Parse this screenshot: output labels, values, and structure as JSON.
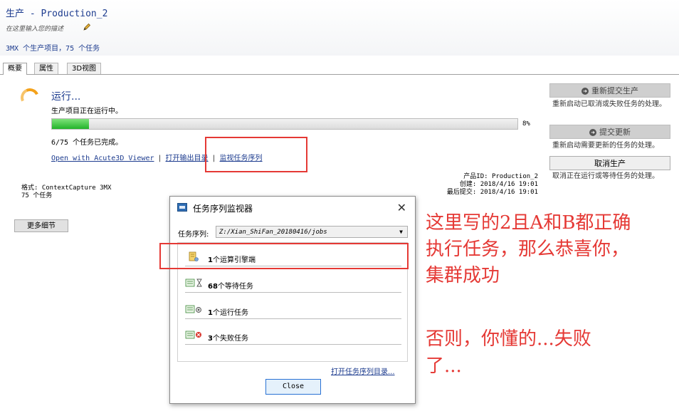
{
  "header": {
    "title": "生产 - Production_2",
    "description_placeholder": "在这里输入您的描述",
    "counts": "3MX 个生产项目，75 个任务"
  },
  "tabs": [
    {
      "label": "概要"
    },
    {
      "label": "属性"
    },
    {
      "label": "3D视图"
    }
  ],
  "status": {
    "label": "运行...",
    "description": "生产项目正在运行中。",
    "progress_percent": 8,
    "progress_text": "8%",
    "tasks_done": "6/75 个任务已完成。"
  },
  "links": {
    "viewer": "Open with Acute3D Viewer",
    "output_dir": "打开输出目录",
    "monitor": "监视任务序列",
    "separator": "|"
  },
  "info": {
    "format_line": "格式: ContextCapture 3MX",
    "tasks_line": "75 个任务",
    "product_id": "产品ID: Production_2",
    "created": "创建: 2018/4/16 19:01",
    "last_submitted": "最后提交: 2018/4/16 19:01"
  },
  "more_details_button": "更多细节",
  "side_actions": {
    "resubmit_label": "重新提交生产",
    "resubmit_desc": "重新启动已取消或失败任务的处理。",
    "submit_update_label": "提交更新",
    "submit_update_desc": "重新启动需要更新的任务的处理。",
    "cancel_label": "取消生产",
    "cancel_desc": "取消正在运行或等待任务的处理。"
  },
  "dialog": {
    "title": "任务序列监视器",
    "close_glyph": "✕",
    "queue_label": "任务序列:",
    "queue_path": "Z:/Xian_ShiFan_20180416/jobs",
    "items": [
      {
        "count": "1",
        "label": "个运算引擎端",
        "icon": "engine-icon"
      },
      {
        "count": "68",
        "label": "个等待任务",
        "icon": "waiting-tasks-icon"
      },
      {
        "count": "1",
        "label": "个运行任务",
        "icon": "running-tasks-icon"
      },
      {
        "count": "3",
        "label": "个失败任务",
        "icon": "failed-tasks-icon"
      }
    ],
    "open_dir_link": "打开任务序列目录...",
    "close_button": "Close"
  },
  "annotations": {
    "line1": "这里写的2且A和B都正确",
    "line2": "执行任务，那么恭喜你，",
    "line3": "集群成功",
    "line4": "否则，你懂的...失败",
    "line5": "了..."
  },
  "colors": {
    "accent": "#1d3c8f",
    "progress": "#22b32a",
    "annotation_red": "#e53935"
  }
}
